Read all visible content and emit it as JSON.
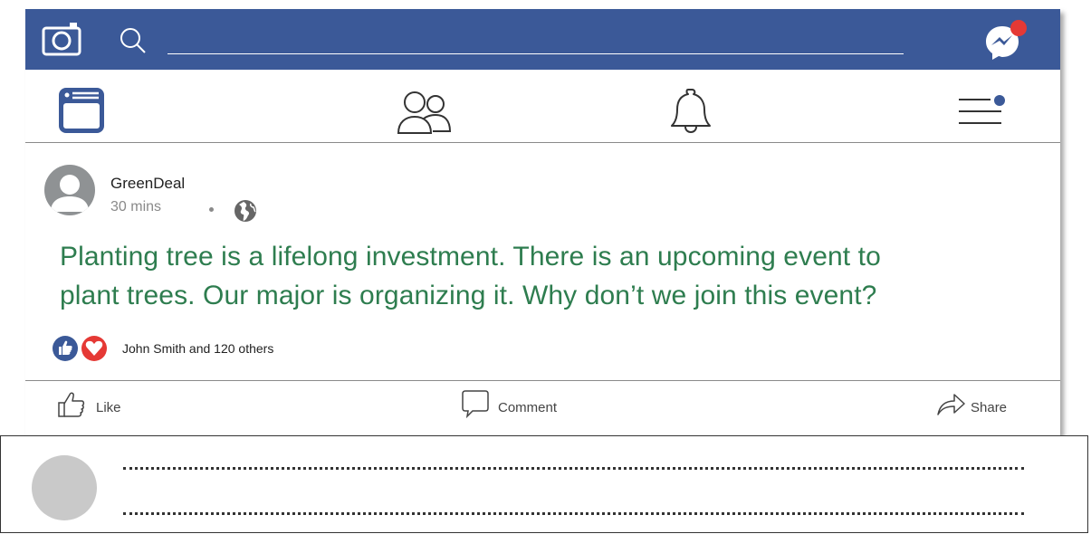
{
  "topbar": {
    "background": "#3b5998",
    "icons": [
      "camera-icon",
      "search-icon",
      "messenger-icon"
    ],
    "search": {
      "value": ""
    },
    "messenger_has_notification": true
  },
  "nav": {
    "items": [
      {
        "name": "news-feed",
        "icon": "news-feed-icon"
      },
      {
        "name": "friends",
        "icon": "friends-icon"
      },
      {
        "name": "notifications",
        "icon": "bell-icon"
      },
      {
        "name": "menu",
        "icon": "menu-icon",
        "has_notification": true
      }
    ]
  },
  "post": {
    "author": "GreenDeal",
    "time": "30 mins",
    "privacy_icon": "globe-icon",
    "text_line1": "Planting tree is a lifelong investment. There is an upcoming event  to",
    "text_line2": "plant trees. Our major is organizing it. Why don’t we join this event?",
    "text_color": "#2e7d4f",
    "reactions": {
      "icons": [
        "like-reaction-icon",
        "love-reaction-icon"
      ],
      "summary": "John Smith and  120 others",
      "like_color": "#3b5998",
      "love_color": "#e53935"
    }
  },
  "actions": {
    "like_label": "Like",
    "comment_label": "Comment",
    "share_label": "Share"
  },
  "comment": {
    "line1": "",
    "line2": ""
  }
}
